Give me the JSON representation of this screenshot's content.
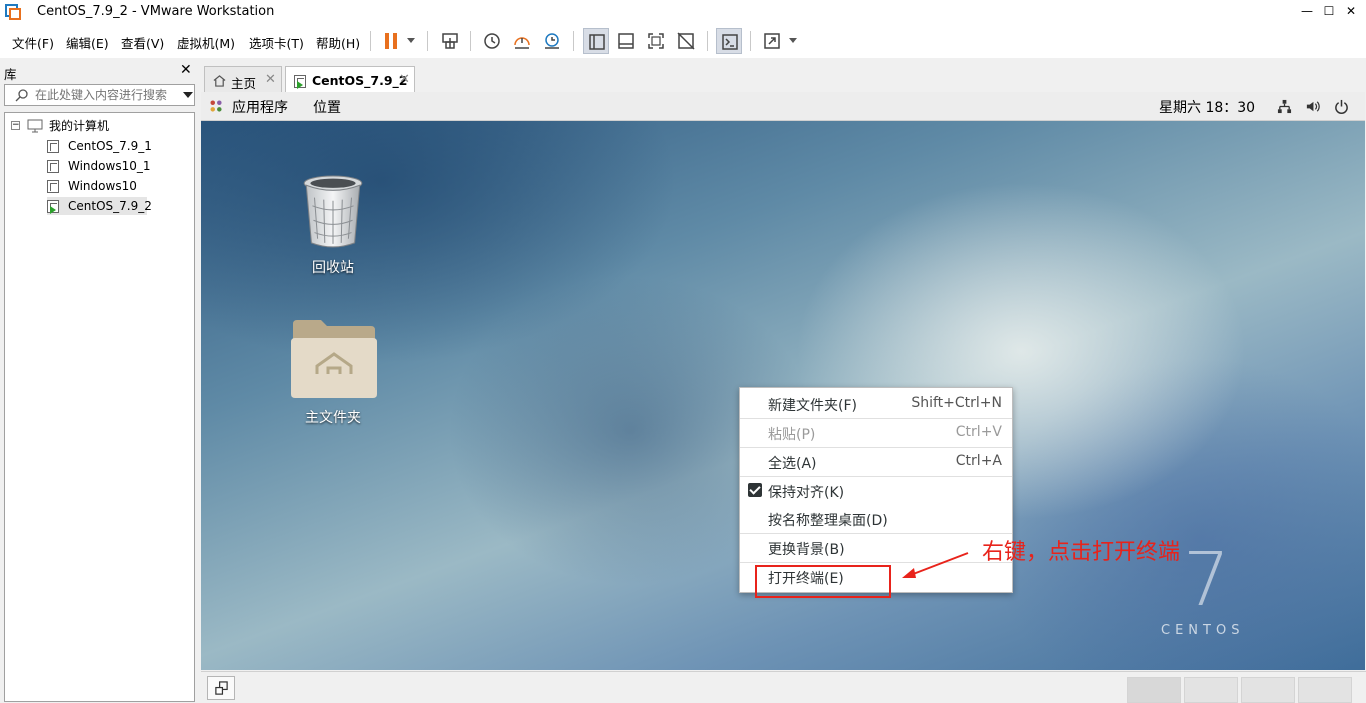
{
  "window": {
    "title": "CentOS_7.9_2 - VMware Workstation",
    "minimize": "—",
    "maximize": "☐",
    "close": "✕"
  },
  "menu": {
    "file": "文件(F)",
    "edit": "编辑(E)",
    "view": "查看(V)",
    "vm": "虚拟机(M)",
    "tabs": "选项卡(T)",
    "help": "帮助(H)"
  },
  "library": {
    "title": "库",
    "close": "✕",
    "search_placeholder": "在此处键入内容进行搜索",
    "root": "我的计算机",
    "items": [
      {
        "label": "CentOS_7.9_1"
      },
      {
        "label": "Windows10_1"
      },
      {
        "label": "Windows10"
      },
      {
        "label": "CentOS_7.9_2",
        "selected": true,
        "running": true
      }
    ]
  },
  "tabs": [
    {
      "label": "主页",
      "close": "✕"
    },
    {
      "label": "CentOS_7.9_2",
      "close": "✕",
      "active": true
    }
  ],
  "guest": {
    "top_bar": {
      "applications": "应用程序",
      "places": "位置",
      "clock": "星期六 18：30"
    },
    "desktop_icons": [
      {
        "label": "回收站",
        "icon": "trash-icon"
      },
      {
        "label": "主文件夹",
        "icon": "home-folder-icon"
      }
    ],
    "context_menu": [
      {
        "label": "新建文件夹(F)",
        "shortcut": "Shift+Ctrl+N",
        "enabled": true
      },
      {
        "label": "粘贴(P)",
        "shortcut": "Ctrl+V",
        "enabled": false
      },
      {
        "label": "全选(A)",
        "shortcut": "Ctrl+A",
        "enabled": true
      },
      {
        "label": "保持对齐(K)",
        "checked": true,
        "enabled": true
      },
      {
        "label": "按名称整理桌面(D)",
        "enabled": true
      },
      {
        "label": "更换背景(B)",
        "enabled": true
      },
      {
        "label": "打开终端(E)",
        "enabled": true
      }
    ],
    "brand_number": "7",
    "brand_text": "CENTOS"
  },
  "annotation": {
    "text": "右键，点击打开终端",
    "color": "#e8231b"
  },
  "colors": {
    "accent_orange": "#e8701e",
    "annotation_red": "#e8231b"
  }
}
